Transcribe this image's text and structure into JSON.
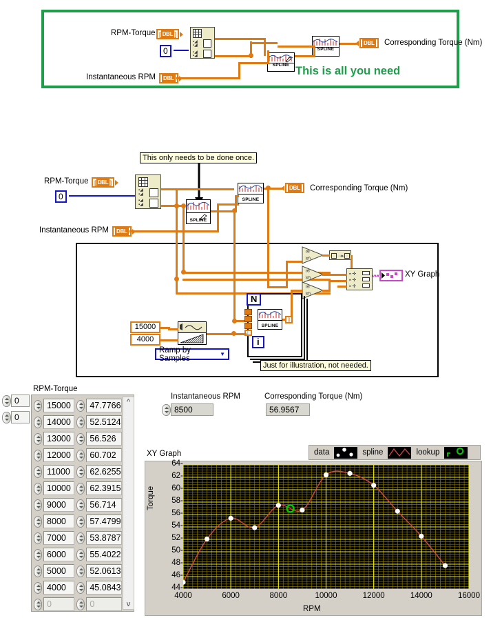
{
  "diagram_top": {
    "banner_text": "This is all you need",
    "controls": [
      {
        "name": "RPM-Torque",
        "type": "DBL-array"
      },
      {
        "name": "Instantaneous RPM",
        "type": "DBL"
      }
    ],
    "constant": "0",
    "indicator": "Corresponding Torque (Nm)",
    "vi_labels": [
      "SPLINE",
      "SPLINE"
    ]
  },
  "diagram_main": {
    "comment_top": "This only needs to be done once.",
    "comment_loop": "Just for illustration, not needed.",
    "controls": [
      {
        "name": "RPM-Torque",
        "type": "DBL-array"
      },
      {
        "name": "Instantaneous RPM",
        "type": "DBL"
      }
    ],
    "constant": "0",
    "indicator": "Corresponding Torque (Nm)",
    "graph_indicator": "XY Graph",
    "vi_labels": [
      "SPLINE",
      "SPLINE",
      "SPLINE"
    ],
    "loop_count_label": "N",
    "loop_index_label": "i",
    "ramp_max": "15000",
    "ramp_min": "4000",
    "ramp_mode": "Ramp by Samples"
  },
  "front_panel": {
    "array_label": "RPM-Torque",
    "index_values": [
      "0",
      "0"
    ],
    "array_rows": [
      {
        "rpm": "15000",
        "torque": "47.7766"
      },
      {
        "rpm": "14000",
        "torque": "52.5124"
      },
      {
        "rpm": "13000",
        "torque": "56.526"
      },
      {
        "rpm": "12000",
        "torque": "60.702"
      },
      {
        "rpm": "11000",
        "torque": "62.6255"
      },
      {
        "rpm": "10000",
        "torque": "62.3915"
      },
      {
        "rpm": "9000",
        "torque": "56.714"
      },
      {
        "rpm": "8000",
        "torque": "57.4799"
      },
      {
        "rpm": "7000",
        "torque": "53.8787"
      },
      {
        "rpm": "6000",
        "torque": "55.4022"
      },
      {
        "rpm": "5000",
        "torque": "52.0613"
      },
      {
        "rpm": "4000",
        "torque": "45.0843"
      },
      {
        "rpm": "0",
        "torque": "0"
      }
    ],
    "instantaneous_rpm_label": "Instantaneous RPM",
    "instantaneous_rpm_value": "8500",
    "corresponding_torque_label": "Corresponding Torque (Nm)",
    "corresponding_torque_value": "56.9567",
    "graph_title": "XY Graph",
    "legend": [
      {
        "label": "data",
        "style": "points",
        "color": "#ffffff"
      },
      {
        "label": "spline",
        "style": "line",
        "color": "#d14a4a"
      },
      {
        "label": "lookup",
        "style": "marker",
        "color": "#00cc00"
      }
    ]
  },
  "chart_data": {
    "type": "scatter",
    "title": "XY Graph",
    "xlabel": "RPM",
    "ylabel": "Torque",
    "xlim": [
      4000,
      16000
    ],
    "ylim": [
      44,
      64
    ],
    "xticks": [
      4000,
      6000,
      8000,
      10000,
      12000,
      14000,
      16000
    ],
    "yticks": [
      44,
      46,
      48,
      50,
      52,
      54,
      56,
      58,
      60,
      62,
      64
    ],
    "grid": true,
    "legend_position": "top-right",
    "series": [
      {
        "name": "data",
        "style": "points",
        "color": "#ffffff",
        "x": [
          4000,
          5000,
          6000,
          7000,
          8000,
          9000,
          10000,
          11000,
          12000,
          13000,
          14000,
          15000
        ],
        "y": [
          45.0843,
          52.0613,
          55.4022,
          53.8787,
          57.4799,
          56.714,
          62.3915,
          62.6255,
          60.702,
          56.526,
          52.5124,
          47.7766
        ]
      },
      {
        "name": "spline",
        "style": "line",
        "color": "#d14a4a",
        "x": [
          4000,
          5000,
          6000,
          7000,
          8000,
          9000,
          10000,
          11000,
          12000,
          13000,
          14000,
          15000
        ],
        "y": [
          45.0843,
          52.0613,
          55.4022,
          53.8787,
          57.4799,
          56.714,
          62.3915,
          62.6255,
          60.702,
          56.526,
          52.5124,
          47.7766
        ]
      },
      {
        "name": "lookup",
        "style": "marker",
        "color": "#00cc00",
        "x": [
          8500
        ],
        "y": [
          56.9567
        ]
      }
    ]
  }
}
